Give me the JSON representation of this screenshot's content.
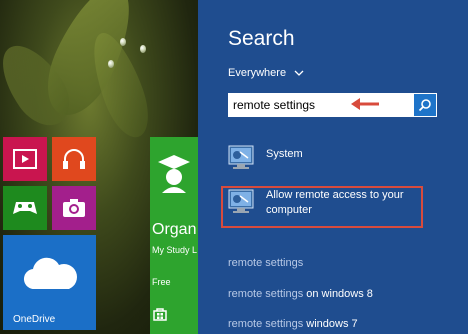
{
  "start_screen": {
    "tiles": {
      "onedrive_label": "OneDrive",
      "organizer_title": "Organ",
      "organizer_subtitle": "My Study L",
      "organizer_price": "Free"
    }
  },
  "search_pane": {
    "title": "Search",
    "scope": "Everywhere",
    "query": "remote settings",
    "results": [
      {
        "label": "System",
        "icon": "control-panel-icon"
      },
      {
        "label_line1": "Allow remote access to your",
        "label_line2": "computer",
        "icon": "control-panel-icon"
      }
    ],
    "suggestions": [
      {
        "highlight": "remote settings",
        "rest": ""
      },
      {
        "highlight": "remote settings",
        "rest": " on windows 8"
      },
      {
        "highlight": "remote settings",
        "rest": " windows 7"
      }
    ]
  },
  "colors": {
    "search_pane_bg": "#1f4d8f",
    "annotation_red": "#d84b3c",
    "search_button": "#1e74c9"
  }
}
